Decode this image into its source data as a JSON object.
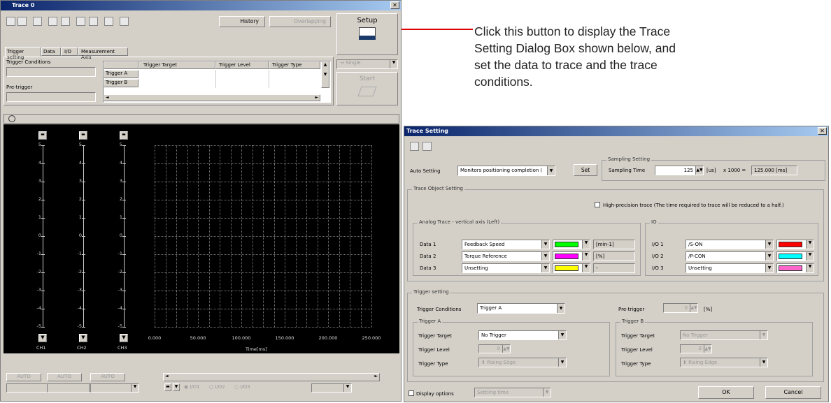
{
  "annotation": "Click this button to display the Trace Setting Dialog Box shown below, and set the data to trace and the trace conditions.",
  "trace_win": {
    "title": "Trace 0",
    "history": "History",
    "overlapping": "Overlapping",
    "setup": "Setup",
    "tabs": [
      "Trigger setting",
      "Data",
      "I/O",
      "Measurement Axis"
    ],
    "trigger_conditions_label": "Trigger Conditions",
    "pretrigger_label": "Pre-trigger",
    "table_headers": [
      "Trigger Target",
      "Trigger Level",
      "Trigger Type"
    ],
    "table_rows": [
      "Trigger A",
      "Trigger B"
    ],
    "single": "Single",
    "start": "Start",
    "y_ticks": [
      "5",
      "4",
      "3",
      "2",
      "1",
      "0",
      "-1",
      "-2",
      "-3",
      "-4",
      "-5"
    ],
    "channels": [
      "CH1",
      "CH2",
      "CH3"
    ],
    "x_ticks": [
      "0.000",
      "50.000",
      "100.000",
      "150.000",
      "200.000",
      "250.000"
    ],
    "x_label": "Time[ms]",
    "auto": "AUTO",
    "io_options": [
      "I/O1",
      "I/O2",
      "I/O3"
    ]
  },
  "dialog": {
    "title": "Trace Setting",
    "auto_setting_label": "Auto Setting",
    "auto_setting_value": "Monitors positioning completion (",
    "set": "Set",
    "sampling_group": "Sampling Setting",
    "sampling_time_label": "Sampling Time",
    "sampling_time_value": "125",
    "sampling_unit": "[us]",
    "sampling_mult": "x 1000 =",
    "sampling_result": "125.000 [ms]",
    "object_group": "Trace Object Setting",
    "high_precision": "High-precision trace (The time required to trace will be reduced to a half.)",
    "analog_group": "Analog Trace - vertical axis (Left)",
    "io_group": "IO",
    "data_rows": [
      {
        "label": "Data 1",
        "value": "Feedback Speed",
        "color": "#00ff00",
        "unit": "[min-1]"
      },
      {
        "label": "Data 2",
        "value": "Torque Reference",
        "color": "#ff00ff",
        "unit": "[%]"
      },
      {
        "label": "Data 3",
        "value": "Unsetting",
        "color": "#ffff00",
        "unit": "-"
      }
    ],
    "io_rows": [
      {
        "label": "I/O 1",
        "value": "/S-ON",
        "color": "#ff0000"
      },
      {
        "label": "I/O 2",
        "value": "/P-CON",
        "color": "#00ffff"
      },
      {
        "label": "I/O 3",
        "value": "Unsetting",
        "color": "#ff66cc"
      }
    ],
    "trigger_group": "Trigger setting",
    "trigger_conditions_label": "Trigger Conditions",
    "trigger_conditions_value": "Trigger A",
    "pretrigger_label": "Pre-trigger",
    "pretrigger_value": "0",
    "pretrigger_unit": "[%]",
    "trigger_a": {
      "group": "Trigger A",
      "target_label": "Trigger Target",
      "target_value": "No Trigger",
      "level_label": "Trigger Level",
      "level_value": "0",
      "type_label": "Trigger Type",
      "type_value": "Rising Edge"
    },
    "trigger_b": {
      "group": "Trigger B",
      "target_label": "Trigger Target",
      "target_value": "No Trigger",
      "level_label": "Trigger Level",
      "level_value": "0",
      "type_label": "Trigger Type",
      "type_value": "Rising Edge"
    },
    "display_options": "Display options",
    "display_options_value": "Settling time",
    "ok": "OK",
    "cancel": "Cancel"
  }
}
